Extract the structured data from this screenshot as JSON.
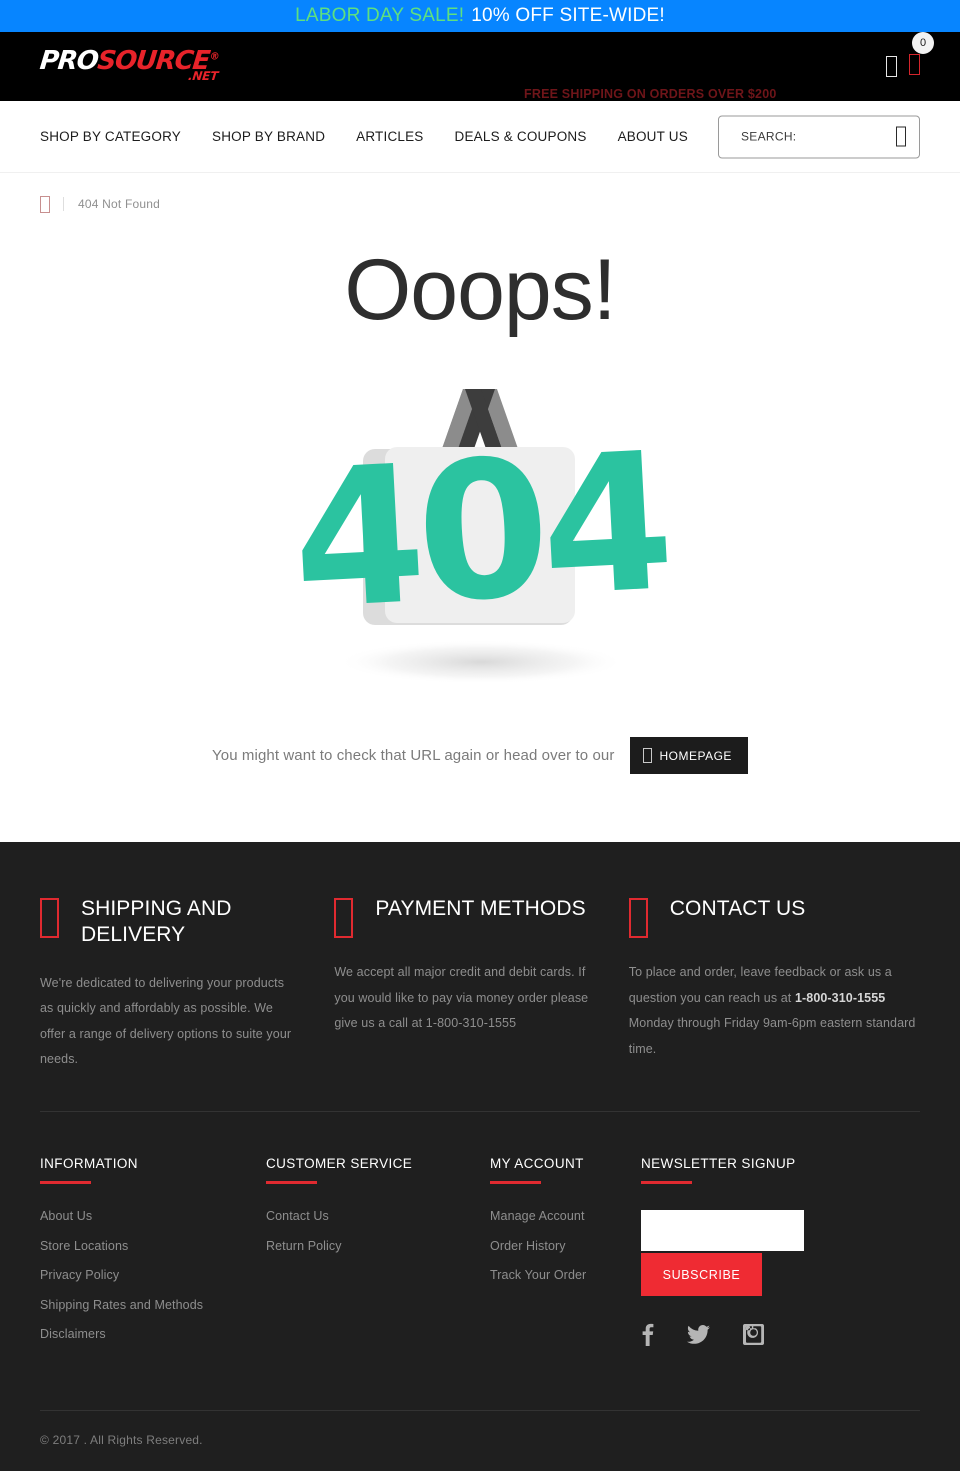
{
  "promo": {
    "highlight": "LABOR DAY SALE!",
    "rest": "10% OFF SITE-WIDE!",
    "bg_color": "#0785ff",
    "highlight_color": "#5ee07f"
  },
  "header": {
    "logo": {
      "part1": "PRO",
      "part2": "SOURCE",
      "registered": "®",
      "suffix": ".NET"
    },
    "free_shipping": "FREE SHIPPING ON ORDERS OVER $200",
    "account_icon": "user-icon",
    "cart_icon": "cart-icon",
    "cart_count": "0"
  },
  "nav": {
    "items": [
      {
        "label": "SHOP BY CATEGORY"
      },
      {
        "label": "SHOP BY BRAND"
      },
      {
        "label": "ARTICLES"
      },
      {
        "label": "DEALS & COUPONS"
      },
      {
        "label": "ABOUT US"
      }
    ],
    "search": {
      "placeholder": "SEARCH:",
      "value": "",
      "icon": "search-icon"
    }
  },
  "breadcrumb": {
    "home_icon": "home-icon",
    "current": "404 Not Found"
  },
  "main": {
    "heading": "Ooops!",
    "art": {
      "name": "404-shopping-bag-illustration",
      "digits": "404",
      "digit_color": "#2bc3a0",
      "bag_color": "#ededed",
      "handle_color": "#7d7d7d"
    },
    "hint_text": "You might want to check that URL again or head over to our",
    "homepage_button": {
      "label": "HOMEPAGE",
      "icon": "home-icon"
    }
  },
  "footer": {
    "info_blocks": [
      {
        "icon": "truck-icon",
        "title": "SHIPPING AND DELIVERY",
        "body": "We're dedicated to delivering your products as quickly and affordably as possible. We offer a range of delivery options to suite your needs."
      },
      {
        "icon": "credit-card-icon",
        "title": "PAYMENT METHODS",
        "body": "We accept all major credit and debit cards. If you would like to pay via money order please give us a call at 1-800-310-1555"
      },
      {
        "icon": "phone-icon",
        "title": "CONTACT US",
        "body_pre": "To place and order, leave feedback or ask us a question you can reach us at ",
        "body_phone": "1-800-310-1555",
        "body_post": " Monday through Friday 9am-6pm eastern standard time."
      }
    ],
    "link_columns": [
      {
        "title": "INFORMATION",
        "items": [
          "About Us",
          "Store Locations",
          "Privacy Policy",
          "Shipping Rates and Methods",
          "Disclaimers"
        ]
      },
      {
        "title": "CUSTOMER SERVICE",
        "items": [
          "Contact Us",
          "Return Policy"
        ]
      },
      {
        "title": "MY ACCOUNT",
        "items": [
          "Manage Account",
          "Order History",
          "Track Your Order"
        ]
      }
    ],
    "newsletter": {
      "title": "NEWSLETTER SIGNUP",
      "input_value": "",
      "input_placeholder": "",
      "button_label": "SUBSCRIBE",
      "socials": [
        "facebook-icon",
        "twitter-icon",
        "instagram-icon"
      ]
    },
    "copyright": "© 2017 . All Rights Reserved.",
    "accent_color": "#e02a30"
  }
}
